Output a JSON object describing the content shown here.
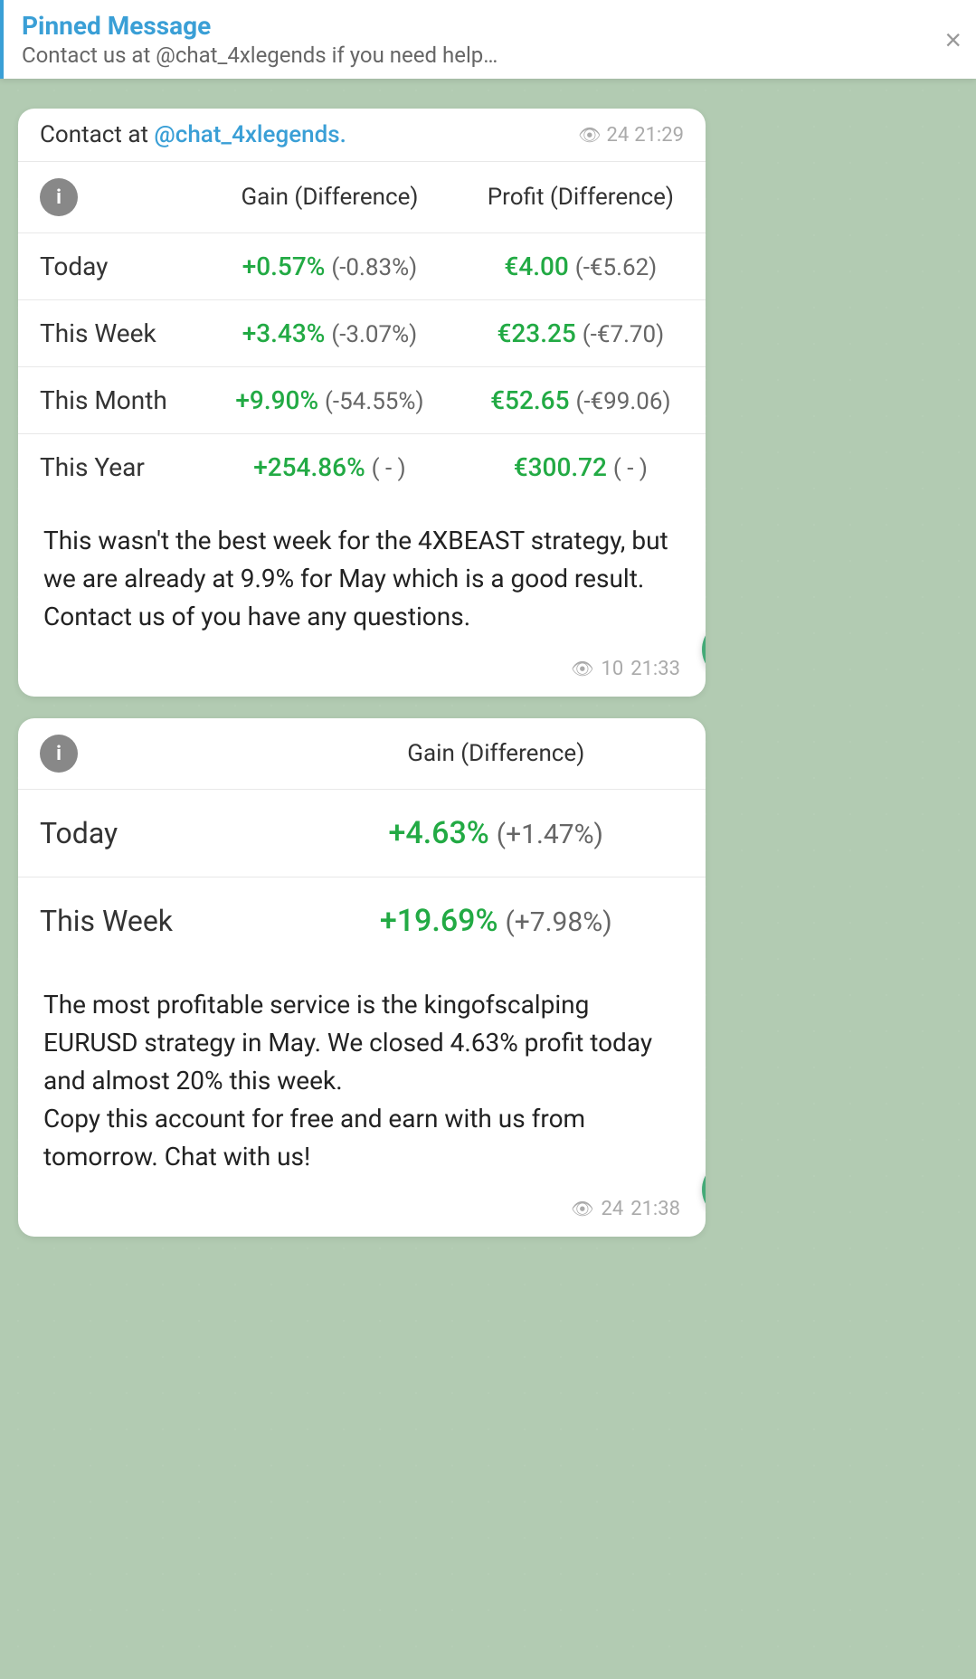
{
  "pinned": {
    "title": "Pinned Message",
    "subtitle": "Contact us at @chat_4xlegends if you need help…",
    "close_label": "×"
  },
  "message1": {
    "contact_text": "Contact at ",
    "contact_handle": "@chat_4xlegends.",
    "contact_suffix": "",
    "views": "24",
    "time": "21:29",
    "table": {
      "col1": "",
      "col2": "Gain (Difference)",
      "col3": "Profit (Difference)",
      "rows": [
        {
          "label": "Today",
          "gain": "+0.57%",
          "gain_diff": "(-0.83%)",
          "profit": "€4.00",
          "profit_diff": "(-€5.62)"
        },
        {
          "label": "This Week",
          "gain": "+3.43%",
          "gain_diff": "(-3.07%)",
          "profit": "€23.25",
          "profit_diff": "(-€7.70)"
        },
        {
          "label": "This Month",
          "gain": "+9.90%",
          "gain_diff": "(-54.55%)",
          "profit": "€52.65",
          "profit_diff": "(-€99.06)"
        },
        {
          "label": "This Year",
          "gain": "+254.86%",
          "gain_diff": "( - )",
          "profit": "€300.72",
          "profit_diff": "( - )"
        }
      ]
    },
    "body_text": "This wasn't the best week for the 4XBEAST strategy, but we are already at 9.9% for May which is a good result. Contact us of you have any questions.",
    "views2": "10",
    "time2": "21:33"
  },
  "message2": {
    "table": {
      "col1": "",
      "col2": "Gain (Difference)",
      "rows": [
        {
          "label": "Today",
          "gain": "+4.63%",
          "gain_diff": "(+1.47%)"
        },
        {
          "label": "This Week",
          "gain": "+19.69%",
          "gain_diff": "(+7.98%)"
        }
      ]
    },
    "body_text": "The most profitable service is the kingofscalping EURUSD strategy in May. We closed 4.63% profit today and almost 20% this week.\nCopy this account for free and earn with us from tomorrow. Chat with us!",
    "views": "24",
    "time": "21:38"
  }
}
